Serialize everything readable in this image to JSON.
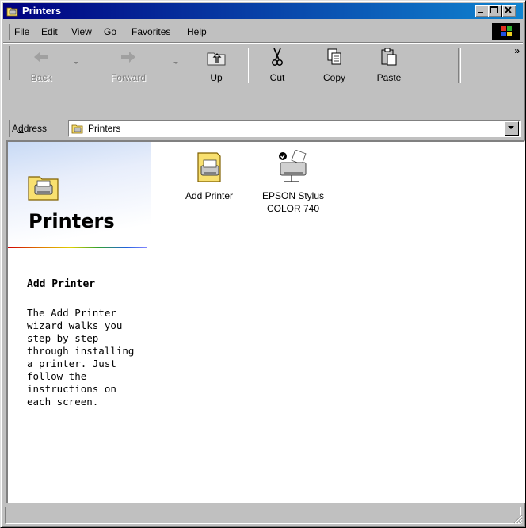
{
  "window": {
    "title": "Printers"
  },
  "menu": [
    {
      "label": "File",
      "key": "F",
      "rest": "ile"
    },
    {
      "label": "Edit",
      "key": "E",
      "rest": "dit"
    },
    {
      "label": "View",
      "key": "V",
      "rest": "iew"
    },
    {
      "label": "Go",
      "key": "G",
      "rest": "o"
    },
    {
      "label": "Favorites",
      "key": "F",
      "pre": "",
      "rest": "avorites"
    },
    {
      "label": "Help",
      "key": "H",
      "rest": "elp"
    }
  ],
  "toolbar": {
    "back": "Back",
    "forward": "Forward",
    "up": "Up",
    "cut": "Cut",
    "copy": "Copy",
    "paste": "Paste",
    "more": "»"
  },
  "address": {
    "label": "Address",
    "value": "Printers"
  },
  "sidebar": {
    "title": "Printers",
    "selected_name": "Add Printer",
    "description": "The Add Printer wizard walks you step-by-step through installing a printer. Just follow the instructions on each screen."
  },
  "items": [
    {
      "label": "Add Printer",
      "icon": "add-printer-icon"
    },
    {
      "label": "EPSON Stylus COLOR 740",
      "icon": "printer-icon"
    }
  ],
  "colors": {
    "title_start": "#000080",
    "title_end": "#1084d0",
    "face": "#c0c0c0"
  }
}
